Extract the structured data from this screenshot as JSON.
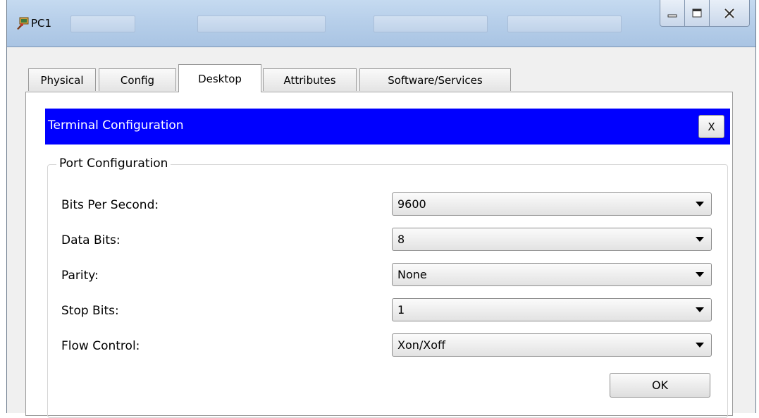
{
  "window": {
    "title": "PC1",
    "app_icon": "packet-tracer-pc-icon",
    "controls": [
      "minimize-icon",
      "maximize-icon",
      "close-icon"
    ]
  },
  "tabs": [
    {
      "label": "Physical",
      "active": false
    },
    {
      "label": "Config",
      "active": false
    },
    {
      "label": "Desktop",
      "active": true
    },
    {
      "label": "Attributes",
      "active": false
    },
    {
      "label": "Software/Services",
      "active": false
    }
  ],
  "dialog": {
    "title": "Terminal Configuration",
    "close_label": "X",
    "header_color": "#0000ff"
  },
  "port_config": {
    "legend": "Port Configuration",
    "fields": [
      {
        "label": "Bits Per Second:",
        "value": "9600"
      },
      {
        "label": "Data Bits:",
        "value": "8"
      },
      {
        "label": "Parity:",
        "value": "None"
      },
      {
        "label": "Stop Bits:",
        "value": "1"
      },
      {
        "label": "Flow Control:",
        "value": "Xon/Xoff"
      }
    ],
    "ok_label": "OK"
  }
}
